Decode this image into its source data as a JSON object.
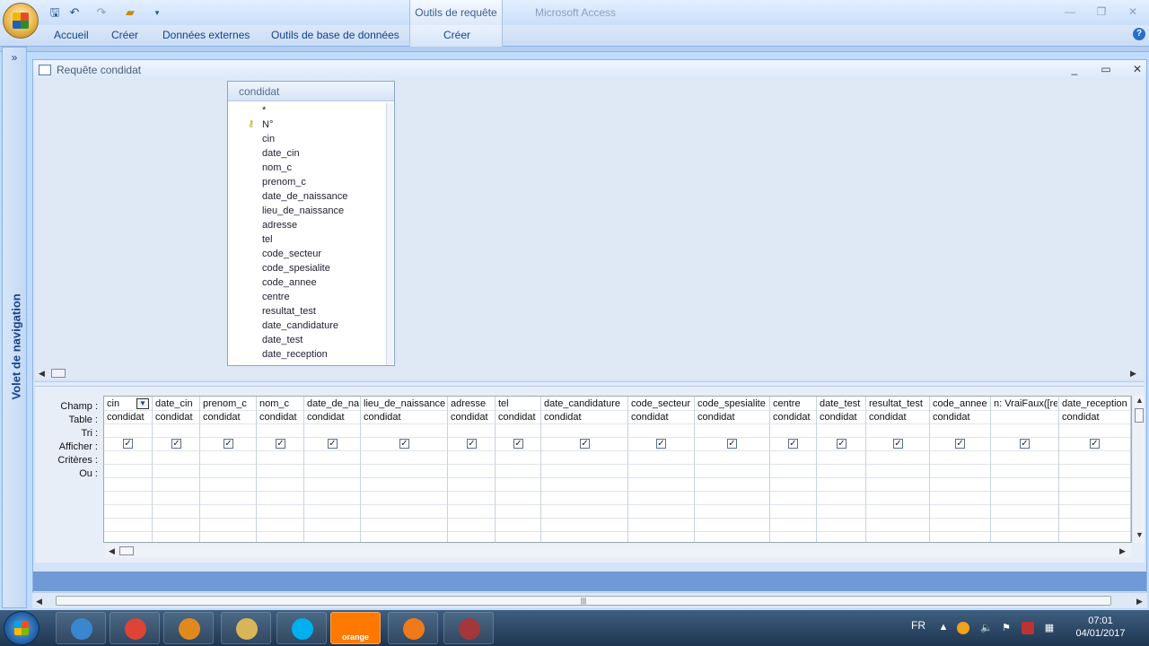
{
  "app": {
    "context_tab": "Outils de requête",
    "title": "Microsoft Access"
  },
  "quick_access": [
    "save-icon",
    "undo-icon",
    "redo-icon",
    "open-icon",
    "customize-icon"
  ],
  "ribbon_tabs": [
    "Accueil",
    "Créer",
    "Données externes",
    "Outils de base de données"
  ],
  "context_ribbon_tab": "Créer",
  "nav_pane": {
    "label": "Volet de navigation",
    "toggle": "»"
  },
  "query_window": {
    "title": "Requête condidat"
  },
  "field_list": {
    "table": "condidat",
    "fields": [
      "*",
      "N°",
      "cin",
      "date_cin",
      "nom_c",
      "prenom_c",
      "date_de_naissance",
      "lieu_de_naissance",
      "adresse",
      "tel",
      "code_secteur",
      "code_spesialite",
      "code_annee",
      "centre",
      "resultat_test",
      "date_candidature",
      "date_test",
      "date_reception"
    ]
  },
  "grid": {
    "row_labels": [
      "Champ :",
      "Table :",
      "Tri :",
      "Afficher :",
      "Critères :",
      "Ou :"
    ],
    "columns": [
      {
        "field": "cin",
        "table": "condidat",
        "show": true
      },
      {
        "field": "date_cin",
        "table": "condidat",
        "show": true
      },
      {
        "field": "prenom_c",
        "table": "condidat",
        "show": true
      },
      {
        "field": "nom_c",
        "table": "condidat",
        "show": true
      },
      {
        "field": "date_de_na",
        "table": "condidat",
        "show": true
      },
      {
        "field": "lieu_de_naissance",
        "table": "condidat",
        "show": true
      },
      {
        "field": "adresse",
        "table": "condidat",
        "show": true
      },
      {
        "field": "tel",
        "table": "condidat",
        "show": true
      },
      {
        "field": "date_candidature",
        "table": "condidat",
        "show": true
      },
      {
        "field": "code_secteur",
        "table": "condidat",
        "show": true
      },
      {
        "field": "code_spesialite",
        "table": "condidat",
        "show": true
      },
      {
        "field": "centre",
        "table": "condidat",
        "show": true
      },
      {
        "field": "date_test",
        "table": "condidat",
        "show": true
      },
      {
        "field": "resultat_test",
        "table": "condidat",
        "show": true
      },
      {
        "field": "code_annee",
        "table": "condidat",
        "show": true
      },
      {
        "field": "n: VraiFaux([re",
        "table": "",
        "show": true
      },
      {
        "field": "date_reception",
        "table": "condidat",
        "show": true
      }
    ]
  },
  "taskbar": {
    "apps": [
      "internet-explorer-icon",
      "chrome-icon",
      "media-player-icon",
      "explorer-icon",
      "skype-icon",
      "orange-icon",
      "avast-icon",
      "access-icon"
    ],
    "orange_label": "orange",
    "lang": "FR",
    "time": "07:01",
    "date": "04/01/2017"
  }
}
